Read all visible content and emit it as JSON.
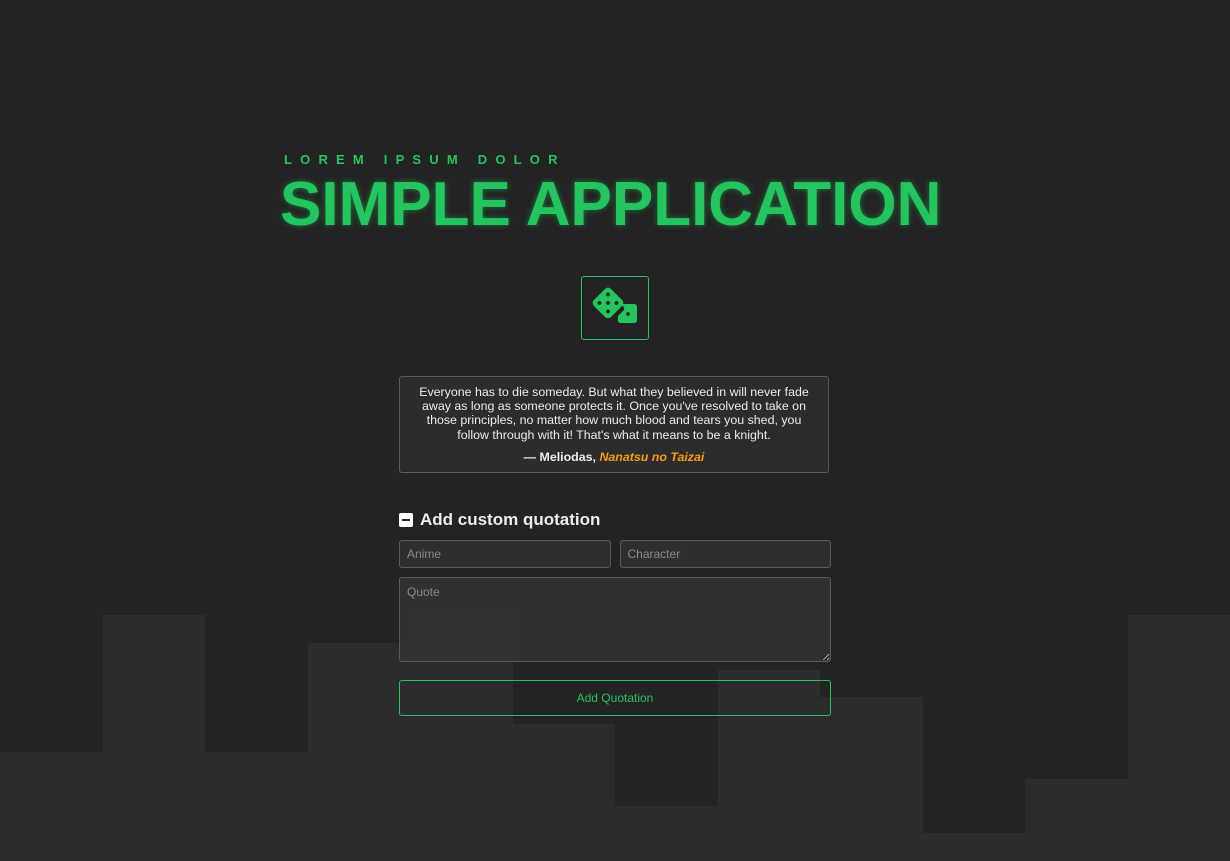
{
  "header": {
    "subtitle": "LOREM IPSUM DOLOR",
    "title": "SIMPLE APPLICATION"
  },
  "random_button": {
    "icon": "dice-icon"
  },
  "quote": {
    "text": "Everyone has to die someday. But what they believed in will never fade away as long as someone protects it. Once you've resolved to take on those principles, no matter how much blood and tears you shed, you follow through with it! That's what it means to be a knight.",
    "dash": "— ",
    "character": "Meliodas",
    "separator": ", ",
    "anime": "Nanatsu no Taizai"
  },
  "form": {
    "toggle_icon": "minus-square-icon",
    "title": "Add custom quotation",
    "anime_placeholder": "Anime",
    "character_placeholder": "Character",
    "quote_placeholder": "Quote",
    "submit_label": "Add Quotation"
  },
  "colors": {
    "background": "#232323",
    "accent": "#22c55e",
    "anime_highlight": "#f59e0b",
    "skyline": "#2c2c2c"
  }
}
